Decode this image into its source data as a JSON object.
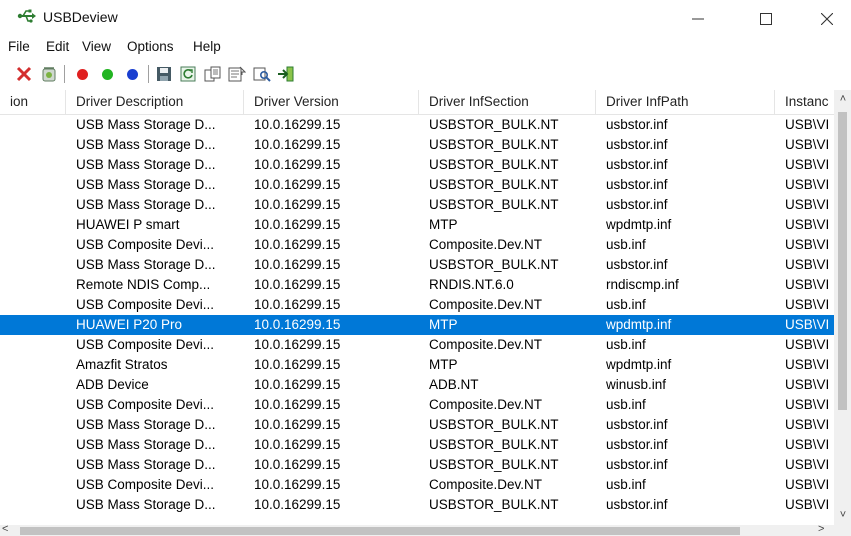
{
  "window": {
    "title": "USBDeview"
  },
  "menu": [
    "File",
    "Edit",
    "View",
    "Options",
    "Help"
  ],
  "toolbar": {
    "icons": [
      "delete-icon",
      "uninstall-icon",
      "disconnect-icon",
      "connect-icon",
      "enable-icon",
      "save-icon",
      "refresh-icon",
      "copy-icon",
      "properties-icon",
      "find-icon",
      "exit-icon"
    ],
    "colors": {
      "delete": "#d32f2f",
      "red_dot": "#e02020",
      "green_dot": "#22b422",
      "blue_dot": "#1a3fd0"
    }
  },
  "table": {
    "columns": [
      "ion",
      "Driver Description",
      "Driver Version",
      "Driver InfSection",
      "Driver InfPath",
      "Instanc"
    ],
    "rows": [
      [
        "",
        "USB Mass Storage D...",
        "10.0.16299.15",
        "USBSTOR_BULK.NT",
        "usbstor.inf",
        "USB\\VI"
      ],
      [
        "",
        "USB Mass Storage D...",
        "10.0.16299.15",
        "USBSTOR_BULK.NT",
        "usbstor.inf",
        "USB\\VI"
      ],
      [
        "",
        "USB Mass Storage D...",
        "10.0.16299.15",
        "USBSTOR_BULK.NT",
        "usbstor.inf",
        "USB\\VI"
      ],
      [
        "",
        "USB Mass Storage D...",
        "10.0.16299.15",
        "USBSTOR_BULK.NT",
        "usbstor.inf",
        "USB\\VI"
      ],
      [
        "",
        "USB Mass Storage D...",
        "10.0.16299.15",
        "USBSTOR_BULK.NT",
        "usbstor.inf",
        "USB\\VI"
      ],
      [
        "",
        "HUAWEI P smart",
        "10.0.16299.15",
        "MTP",
        "wpdmtp.inf",
        "USB\\VI"
      ],
      [
        "",
        "USB Composite Devi...",
        "10.0.16299.15",
        "Composite.Dev.NT",
        "usb.inf",
        "USB\\VI"
      ],
      [
        "",
        "USB Mass Storage D...",
        "10.0.16299.15",
        "USBSTOR_BULK.NT",
        "usbstor.inf",
        "USB\\VI"
      ],
      [
        "",
        "Remote NDIS Comp...",
        "10.0.16299.15",
        "RNDIS.NT.6.0",
        "rndiscmp.inf",
        "USB\\VI"
      ],
      [
        "",
        "USB Composite Devi...",
        "10.0.16299.15",
        "Composite.Dev.NT",
        "usb.inf",
        "USB\\VI"
      ],
      [
        "",
        "HUAWEI P20 Pro",
        "10.0.16299.15",
        "MTP",
        "wpdmtp.inf",
        "USB\\VI"
      ],
      [
        "",
        "USB Composite Devi...",
        "10.0.16299.15",
        "Composite.Dev.NT",
        "usb.inf",
        "USB\\VI"
      ],
      [
        "",
        "Amazfit Stratos",
        "10.0.16299.15",
        "MTP",
        "wpdmtp.inf",
        "USB\\VI"
      ],
      [
        "",
        "ADB Device",
        "10.0.16299.15",
        "ADB.NT",
        "winusb.inf",
        "USB\\VI"
      ],
      [
        "",
        "USB Composite Devi...",
        "10.0.16299.15",
        "Composite.Dev.NT",
        "usb.inf",
        "USB\\VI"
      ],
      [
        "",
        "USB Mass Storage D...",
        "10.0.16299.15",
        "USBSTOR_BULK.NT",
        "usbstor.inf",
        "USB\\VI"
      ],
      [
        "",
        "USB Mass Storage D...",
        "10.0.16299.15",
        "USBSTOR_BULK.NT",
        "usbstor.inf",
        "USB\\VI"
      ],
      [
        "",
        "USB Mass Storage D...",
        "10.0.16299.15",
        "USBSTOR_BULK.NT",
        "usbstor.inf",
        "USB\\VI"
      ],
      [
        "",
        "USB Composite Devi...",
        "10.0.16299.15",
        "Composite.Dev.NT",
        "usb.inf",
        "USB\\VI"
      ],
      [
        "",
        "USB Mass Storage D...",
        "10.0.16299.15",
        "USBSTOR_BULK.NT",
        "usbstor.inf",
        "USB\\VI"
      ]
    ],
    "selected_row": 10,
    "selection_color": "#0078d7"
  }
}
